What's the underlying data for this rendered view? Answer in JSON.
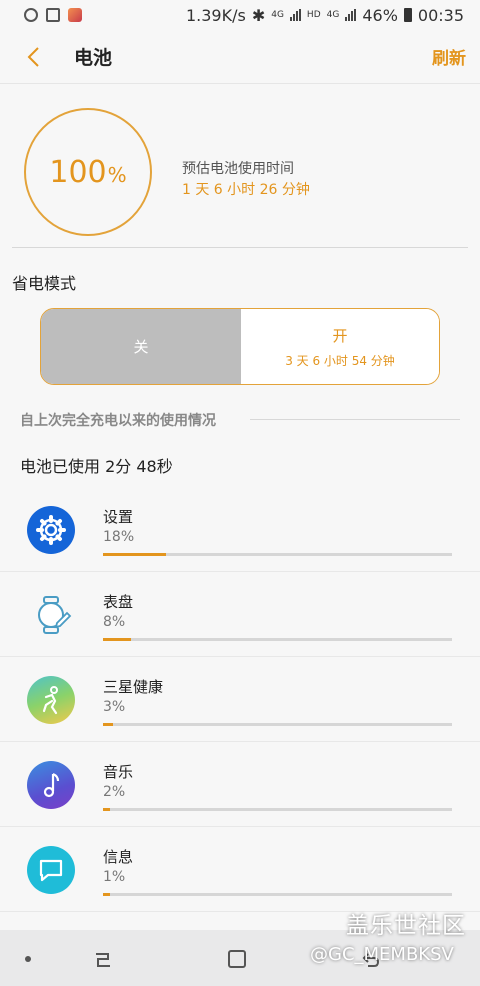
{
  "status_bar": {
    "speed": "1.39K/s",
    "network_a": "4G",
    "network_b": "HD",
    "network_c": "4G",
    "battery": "46%",
    "time": "00:35"
  },
  "header": {
    "title": "电池",
    "refresh_label": "刷新"
  },
  "battery": {
    "percent": "100",
    "percent_sign": "%",
    "estimate_label": "预估电池使用时间",
    "estimate_value": "1 天 6 小时 26 分钟"
  },
  "power_saving": {
    "title": "省电模式",
    "off_label": "关",
    "on_label": "开",
    "on_estimate": "3 天 6 小时 54 分钟",
    "selected": "off"
  },
  "usage": {
    "section_title": "自上次完全充电以来的使用情况",
    "summary": "电池已使用 2分 48秒",
    "apps": [
      {
        "name": "设置",
        "percent": "18%",
        "value": 18,
        "icon": "settings-icon",
        "color": "#1565d8"
      },
      {
        "name": "表盘",
        "percent": "8%",
        "value": 8,
        "icon": "watch-face-icon",
        "color": "#ffffff"
      },
      {
        "name": "三星健康",
        "percent": "3%",
        "value": 3,
        "icon": "samsung-health-icon",
        "color": "#7fcf6a"
      },
      {
        "name": "音乐",
        "percent": "2%",
        "value": 2,
        "icon": "music-icon",
        "color": "#4d5fd6"
      },
      {
        "name": "信息",
        "percent": "1%",
        "value": 1,
        "icon": "message-icon",
        "color": "#1fbcd8"
      }
    ]
  },
  "colors": {
    "accent": "#e3951e",
    "toggle_off_bg": "#bdbdbd"
  },
  "watermark": {
    "title": "盖乐世社区",
    "handle": "@GC_MEMBKSV"
  }
}
